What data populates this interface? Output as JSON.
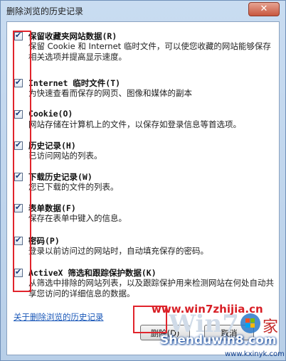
{
  "window": {
    "title": "删除浏览的历史记录",
    "close_label": "✕"
  },
  "options": [
    {
      "title": "保留收藏夹网站数据(R)",
      "desc": "保留 Cookie 和 Internet 临时文件，可以使您收藏的网站能够保存相关选项并提高显示速度。"
    },
    {
      "title": "Internet 临时文件(T)",
      "desc": "为快速查看而保存的网页、图像和媒体的副本"
    },
    {
      "title": "Cookie(O)",
      "desc": "网站存储在计算机上的文件，以保存如登录信息等首选项。"
    },
    {
      "title": "历史记录(H)",
      "desc": "已访问网站的列表。"
    },
    {
      "title": "下载历史记录(W)",
      "desc": "您已下载的文件的列表。"
    },
    {
      "title": "表单数据(F)",
      "desc": "保存在表单中键入的信息。"
    },
    {
      "title": "密码(P)",
      "desc": "登录以前访问过的网站时，自动填充保存的密码。"
    },
    {
      "title": "ActiveX 筛选和跟踪保护数据(K)",
      "desc": "从筛选中排除的网站列表，以及跟踪保护用来检测网站在何处自动共享您访问的详细信息的数据。"
    }
  ],
  "footer": {
    "link": "关于删除浏览的历史记录",
    "delete_label": "删除(D)",
    "cancel_label": "取消"
  },
  "watermark": {
    "url1": "www.win7zhijia.cn",
    "brand": "Shenduwin8.com",
    "url2": "www.kxinyk.com"
  }
}
